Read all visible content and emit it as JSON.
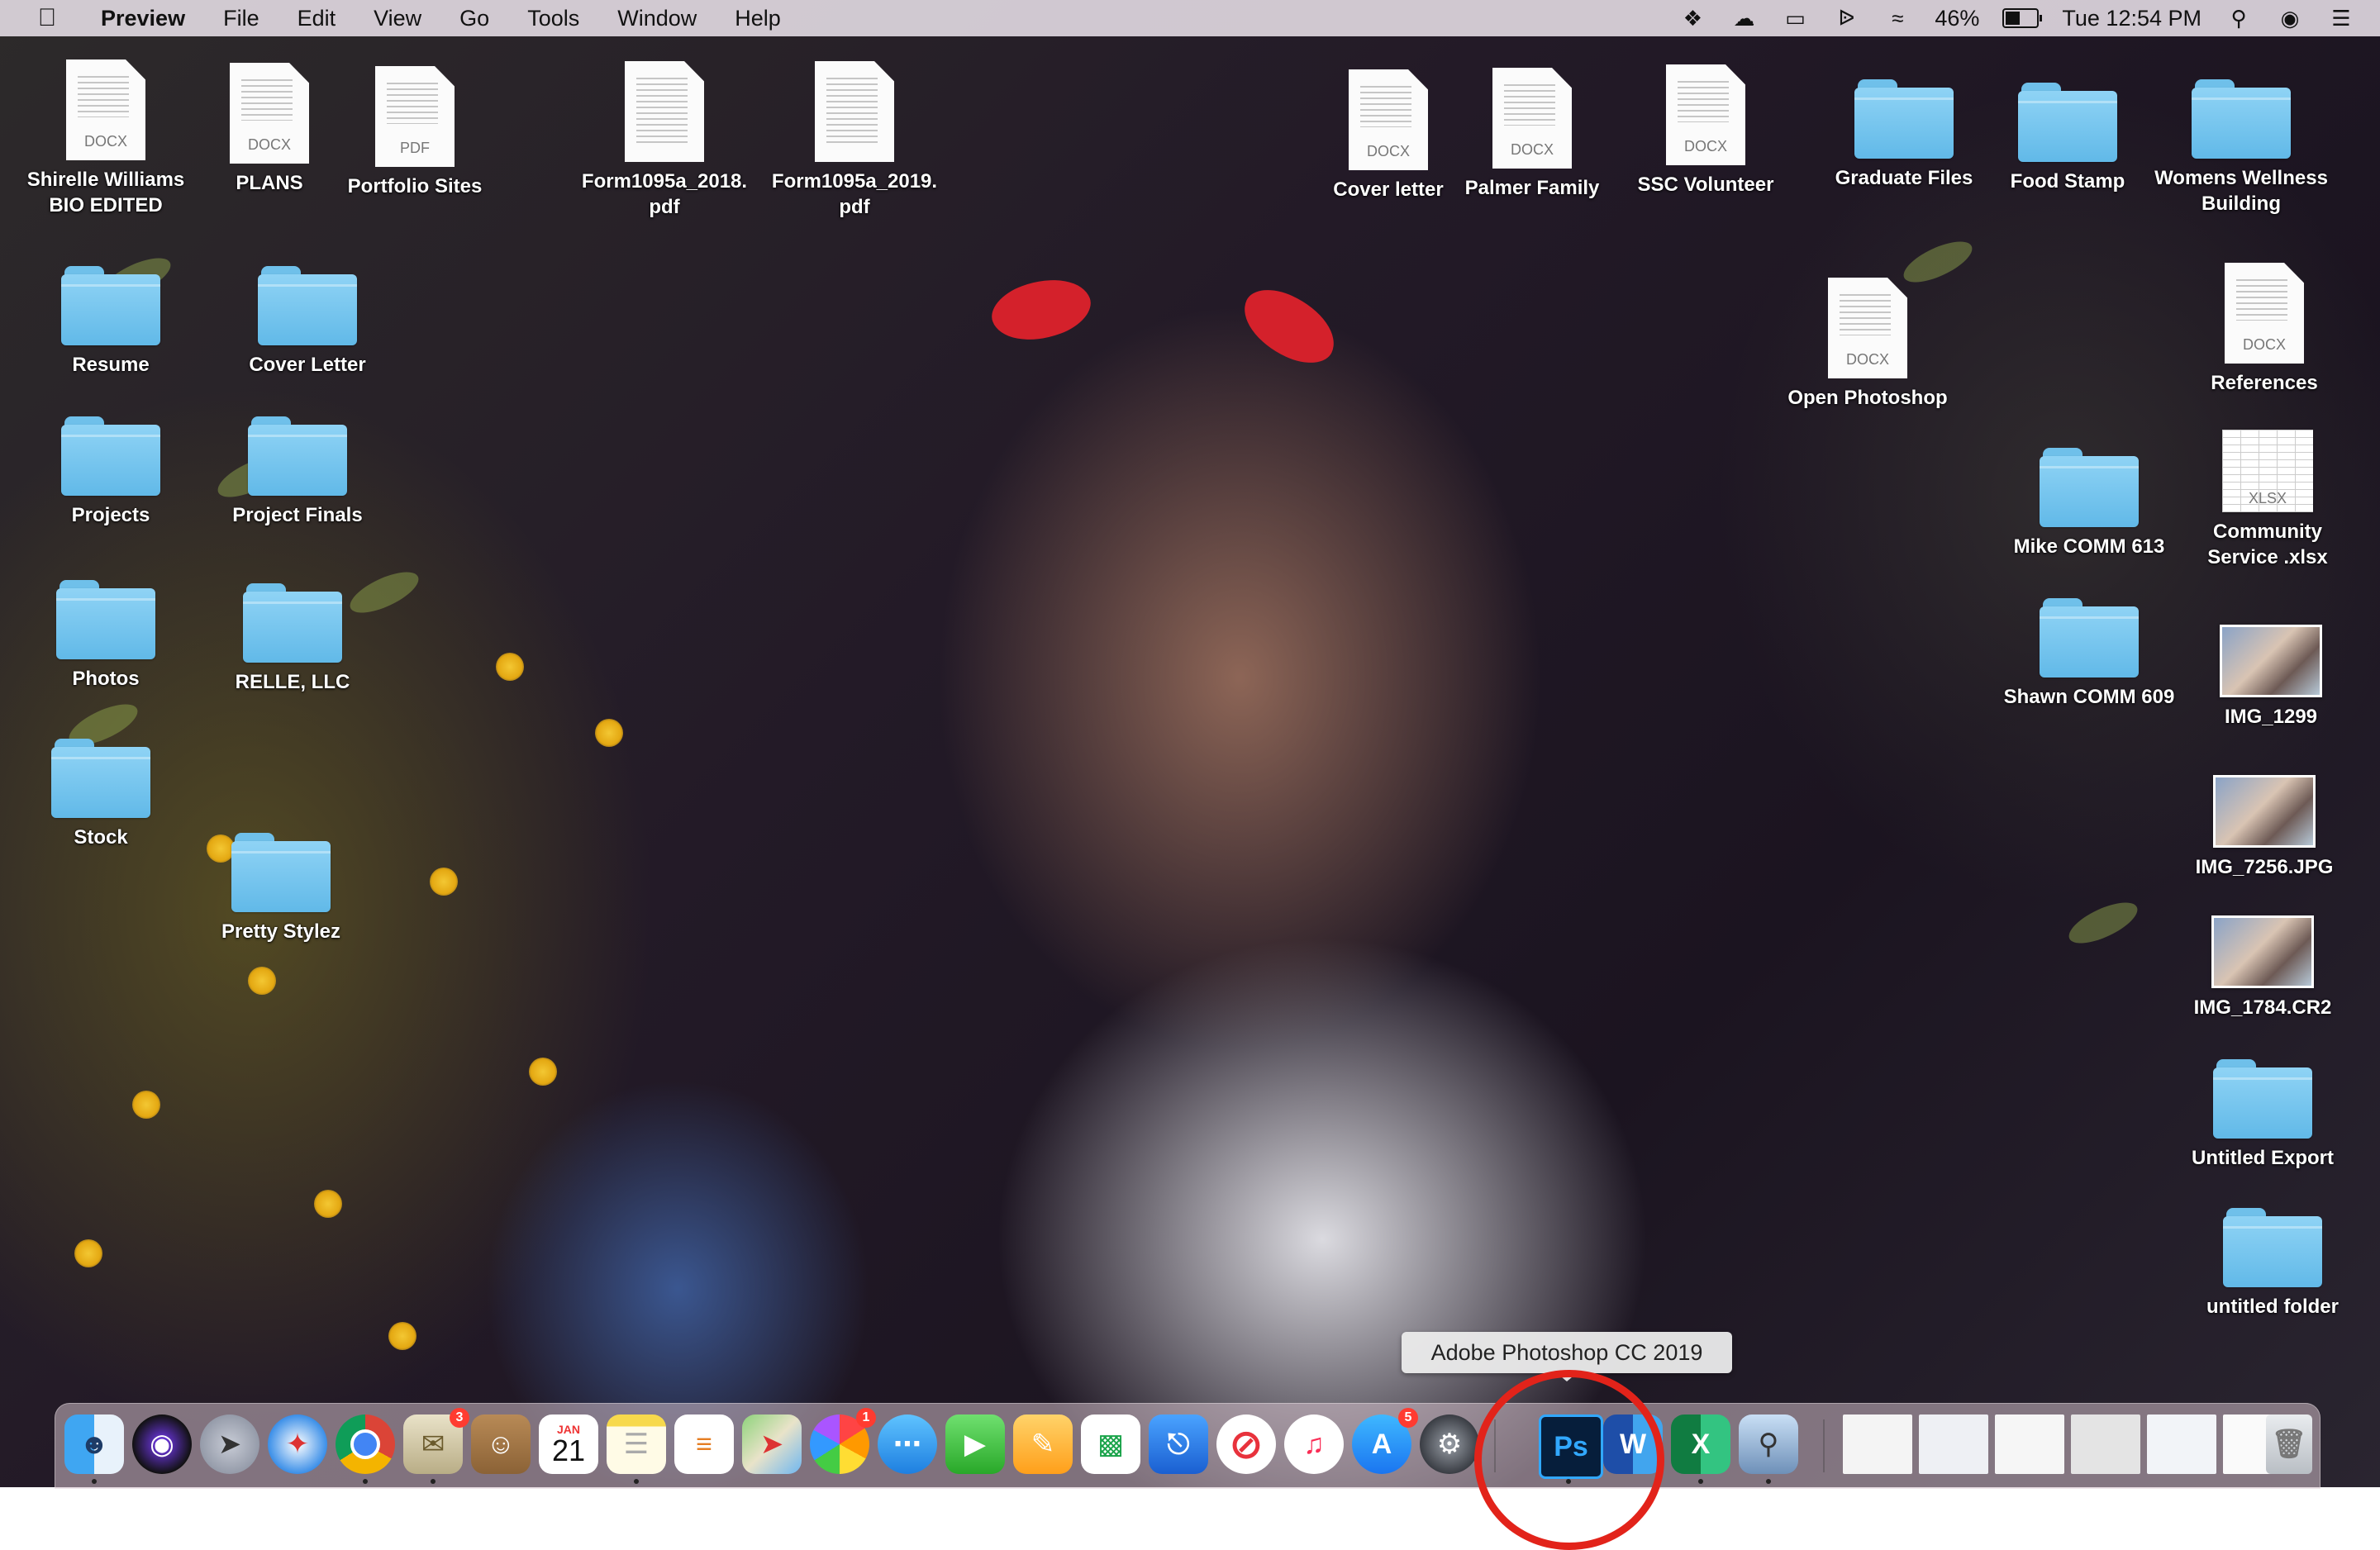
{
  "menubar": {
    "app_name": "Preview",
    "menus": [
      "File",
      "Edit",
      "View",
      "Go",
      "Tools",
      "Window",
      "Help"
    ],
    "battery_percent": "46%",
    "battery_level": 0.46,
    "clock": "Tue 12:54 PM"
  },
  "desktop": {
    "items": [
      {
        "label": "Shirelle Williams\nBIO EDITED",
        "type": "doc",
        "ext": "DOCX"
      },
      {
        "label": "PLANS",
        "type": "doc",
        "ext": "DOCX"
      },
      {
        "label": "Portfolio Sites",
        "type": "doc",
        "ext": "PDF"
      },
      {
        "label": "Form1095a_2018.\npdf",
        "type": "doc",
        "ext": ""
      },
      {
        "label": "Form1095a_2019.\npdf",
        "type": "doc",
        "ext": ""
      },
      {
        "label": "Cover letter",
        "type": "doc",
        "ext": "DOCX"
      },
      {
        "label": "Palmer Family",
        "type": "doc",
        "ext": "DOCX"
      },
      {
        "label": "SSC Volunteer",
        "type": "doc",
        "ext": "DOCX"
      },
      {
        "label": "Graduate Files",
        "type": "folder"
      },
      {
        "label": "Food Stamp",
        "type": "folder"
      },
      {
        "label": "Womens Wellness\nBuilding",
        "type": "folder"
      },
      {
        "label": "Resume",
        "type": "folder"
      },
      {
        "label": "Cover Letter",
        "type": "folder"
      },
      {
        "label": "Open Photoshop",
        "type": "doc",
        "ext": "DOCX"
      },
      {
        "label": "References",
        "type": "doc",
        "ext": "DOCX"
      },
      {
        "label": "Projects",
        "type": "folder"
      },
      {
        "label": "Project Finals",
        "type": "folder"
      },
      {
        "label": "Mike COMM 613",
        "type": "folder"
      },
      {
        "label": "Community\nService .xlsx",
        "type": "sheet",
        "ext": "XLSX"
      },
      {
        "label": "Photos",
        "type": "folder"
      },
      {
        "label": "RELLE, LLC",
        "type": "folder"
      },
      {
        "label": "Shawn COMM 609",
        "type": "folder"
      },
      {
        "label": "IMG_1299",
        "type": "image"
      },
      {
        "label": "Stock",
        "type": "folder"
      },
      {
        "label": "IMG_7256.JPG",
        "type": "image"
      },
      {
        "label": "Pretty Stylez",
        "type": "folder"
      },
      {
        "label": "IMG_1784.CR2",
        "type": "image"
      },
      {
        "label": "Untitled Export",
        "type": "folder"
      },
      {
        "label": "untitled folder",
        "type": "folder"
      }
    ]
  },
  "tooltip": "Adobe Photoshop CC 2019",
  "dock": {
    "calendar_month": "JAN",
    "calendar_day": "21",
    "mail_badge": "3",
    "photos_badge": "1",
    "appstore_badge": "5",
    "photoshop_label": "Ps",
    "word_label": "W",
    "excel_label": "X",
    "apps": [
      "finder-icon",
      "siri-icon",
      "launchpad-icon",
      "safari-icon",
      "chrome-icon",
      "mail-icon",
      "contacts-icon",
      "calendar-icon",
      "notes-icon",
      "reminders-icon",
      "maps-icon",
      "photos-icon",
      "messages-icon",
      "facetime-icon",
      "pages-icon",
      "numbers-icon",
      "keynote-icon",
      "news-icon",
      "music-icon",
      "appstore-icon",
      "system-preferences-icon",
      "photoshop-icon",
      "word-icon",
      "excel-icon",
      "preview-icon"
    ]
  }
}
